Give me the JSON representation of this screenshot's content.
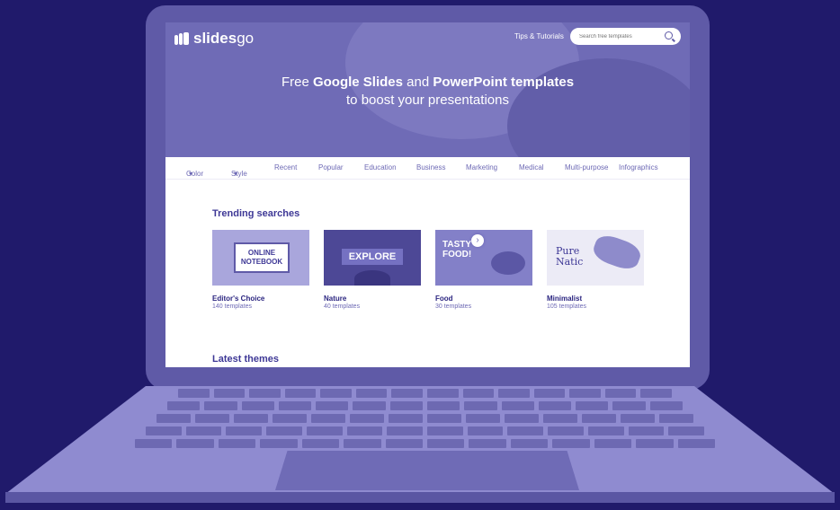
{
  "header": {
    "logo_text": "slides",
    "logo_suffix": "go",
    "tips_link": "Tips & Tutorials",
    "search_placeholder": "Search free templates"
  },
  "hero": {
    "line1_prefix": "Free ",
    "line1_bold1": "Google Slides",
    "line1_mid": " and ",
    "line1_bold2": "PowerPoint templates",
    "line2": "to boost your presentations"
  },
  "nav": {
    "items": [
      "Color",
      "Style",
      "Recent",
      "Popular",
      "Education",
      "Business",
      "Marketing",
      "Medical",
      "Multi-purpose",
      "Infographics"
    ],
    "caret": "▾"
  },
  "trending": {
    "title": "Trending searches",
    "cards": [
      {
        "name": "Editor's Choice",
        "count": "140 templates",
        "thumb_text": "ONLINE NOTEBOOK"
      },
      {
        "name": "Nature",
        "count": "40 templates",
        "thumb_text": "EXPLORE"
      },
      {
        "name": "Food",
        "count": "30 templates",
        "thumb_text": "TASTY FOOD!"
      },
      {
        "name": "Minimalist",
        "count": "105 templates",
        "thumb_text": "Pure Natic"
      }
    ],
    "next_arrow": "›"
  },
  "latest": {
    "title": "Latest themes"
  },
  "colors": {
    "background": "#201a6b",
    "accent": "#6f6bb6",
    "text": "#2b2580"
  }
}
